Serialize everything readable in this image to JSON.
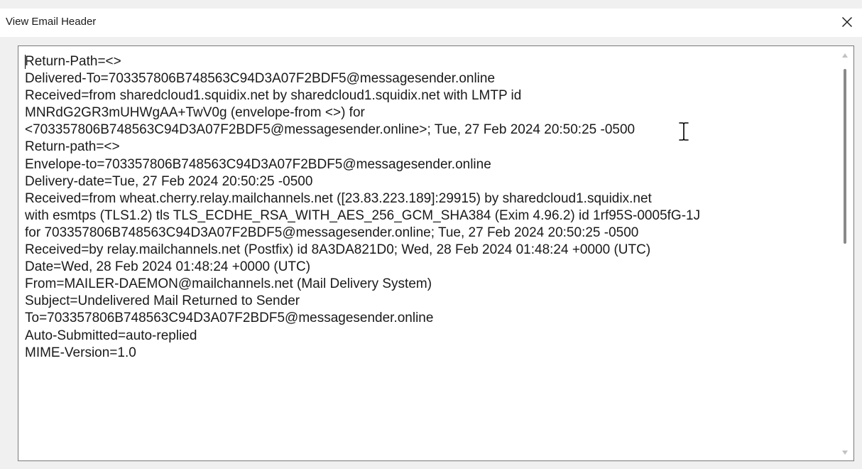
{
  "window": {
    "title": "View Email Header",
    "close_icon": "close-icon"
  },
  "header_lines": [
    "Return-Path=<>",
    "Delivered-To=703357806B748563C94D3A07F2BDF5@messagesender.online",
    "Received=from sharedcloud1.squidix.net by sharedcloud1.squidix.net with LMTP id",
    "MNRdG2GR3mUHWgAA+TwV0g (envelope-from <>) for",
    "<703357806B748563C94D3A07F2BDF5@messagesender.online>; Tue, 27 Feb 2024 20:50:25 -0500",
    "Return-path=<>",
    "Envelope-to=703357806B748563C94D3A07F2BDF5@messagesender.online",
    "Delivery-date=Tue, 27 Feb 2024 20:50:25 -0500",
    "Received=from wheat.cherry.relay.mailchannels.net ([23.83.223.189]:29915) by sharedcloud1.squidix.net",
    "with esmtps  (TLS1.2) tls TLS_ECDHE_RSA_WITH_AES_256_GCM_SHA384 (Exim 4.96.2) id 1rf95S-0005fG-1J",
    "for 703357806B748563C94D3A07F2BDF5@messagesender.online; Tue, 27 Feb 2024 20:50:25 -0500",
    "Received=by relay.mailchannels.net (Postfix) id 8A3DA821D0; Wed, 28 Feb 2024 01:48:24 +0000 (UTC)",
    "Date=Wed, 28 Feb 2024 01:48:24 +0000 (UTC)",
    "From=MAILER-DAEMON@mailchannels.net (Mail Delivery System)",
    "Subject=Undelivered Mail Returned to Sender",
    "To=703357806B748563C94D3A07F2BDF5@messagesender.online",
    "Auto-Submitted=auto-replied",
    "MIME-Version=1.0"
  ],
  "scrollbar": {
    "position_fraction": 0.0
  }
}
